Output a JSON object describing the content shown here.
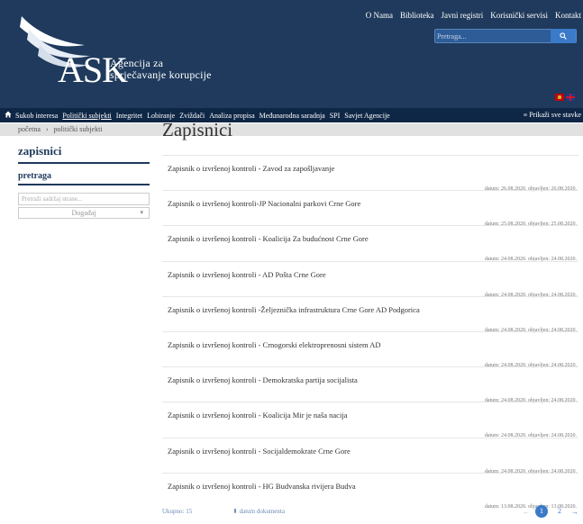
{
  "header": {
    "logo_text": "ASK",
    "agency_line1": "Agencija za",
    "agency_line2": "sprječavanje korupcije",
    "top_links": [
      "O Nama",
      "Biblioteka",
      "Javni registri",
      "Korisnički servisi",
      "Kontakt"
    ],
    "search_placeholder": "Pretraga..."
  },
  "main_nav": {
    "items": [
      "Sukob interesa",
      "Politički subjekti",
      "Integritet",
      "Lobiranje",
      "Zviždači",
      "Analiza propisa",
      "Međunarodna saradnja",
      "SPI",
      "Savjet Agencije"
    ],
    "active": "Politički subjekti",
    "show_all": "Prikaži sve stavke"
  },
  "breadcrumb": {
    "items": [
      "početna",
      "›",
      "politički subjekti"
    ]
  },
  "sidebar": {
    "title": "zapisnici",
    "subtitle": "pretraga",
    "search_placeholder": "Pretraži sadržaj strane...",
    "select_value": "Događaj"
  },
  "content": {
    "title": "Zapisnici",
    "rows": [
      {
        "title": "Zapisnik o izvršenoj kontroli - Zavod za zapošljavanje",
        "date": "datum: 26.08.2020. objavljen: 26.08.2020."
      },
      {
        "title": "Zapisnik o izvršenoj kontroli-JP Nacionalni parkovi Crne Gore",
        "date": "datum: 25.08.2020. objavljen: 25.08.2020."
      },
      {
        "title": "Zapisnik o izvršenoj kontroli - Koalicija Za budućnost Crne Gore",
        "date": "datum: 24.08.2020. objavljen: 24.08.2020."
      },
      {
        "title": "Zapisnik o izvršenoj kontroli - AD Pošta Crne Gore",
        "date": "datum: 24.08.2020. objavljen: 24.08.2020."
      },
      {
        "title": "Zapisnik o izvršenoj kontroli -Željeznička infrastruktura Crne Gore AD Podgorica",
        "date": "datum: 24.08.2020. objavljen: 24.08.2020."
      },
      {
        "title": "Zapisnik o izvršenoj kontroli - Crnogorski elektroprenosni sistem AD",
        "date": "datum: 24.08.2020. objavljen: 24.08.2020."
      },
      {
        "title": "Zapisnik o izvršenoj kontroli - Demokratska partija socijalista",
        "date": "datum: 24.08.2020. objavljen: 24.08.2020."
      },
      {
        "title": "Zapisnik o izvršenoj kontroli - Koalicija Mir je naša nacija",
        "date": "datum: 24.08.2020. objavljen: 24.08.2020."
      },
      {
        "title": "Zapisnik o izvršenoj kontroli - Socijaldemokrate Crne Gore",
        "date": "datum: 24.08.2020. objavljen: 24.08.2020."
      },
      {
        "title": "Zapisnik o izvršenoj kontroli - HG Budvanska rivijera Budva",
        "date": "datum: 13.08.2020. objavljen: 13.08.2020."
      }
    ],
    "total": "Ukupno: 15",
    "sort": "⬇ datum dokumenta",
    "pages": [
      "1",
      "2"
    ]
  },
  "colors": {
    "header_bg": "#1f3a5c",
    "nav_bg": "#0f2746",
    "accent": "#3b7ac8"
  }
}
